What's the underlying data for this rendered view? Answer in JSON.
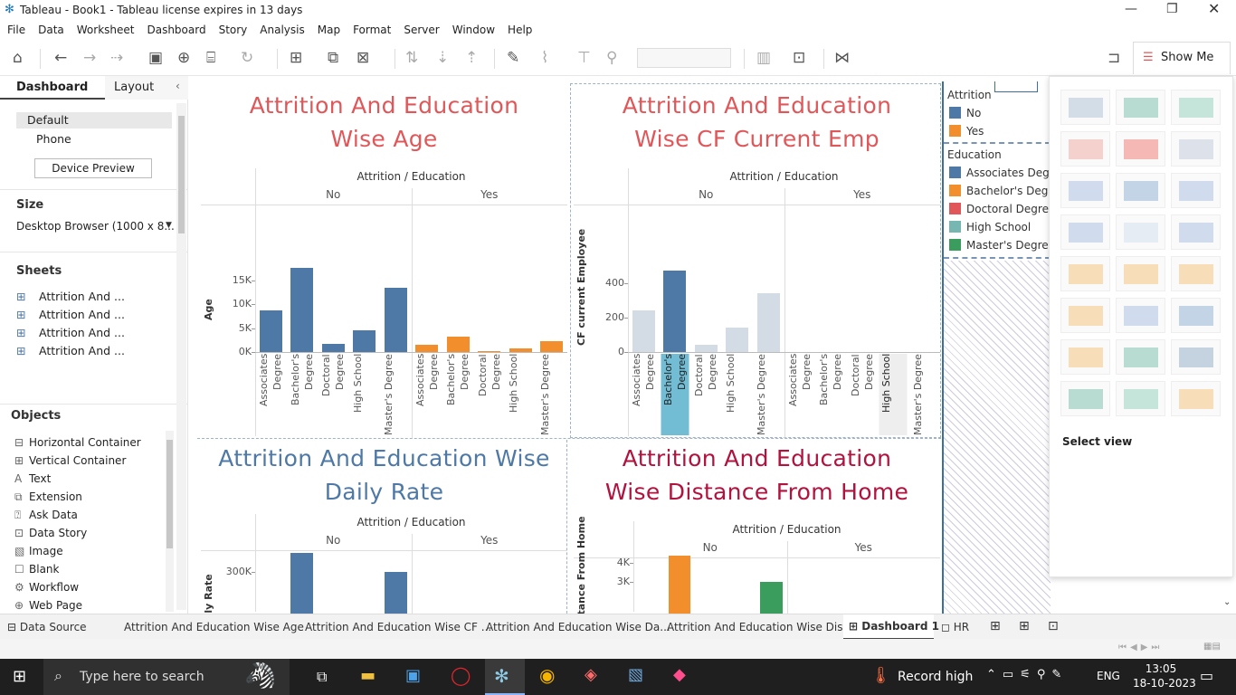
{
  "window": {
    "title": "Tableau - Book1 - Tableau license expires in 13 days"
  },
  "menu": [
    "File",
    "Data",
    "Worksheet",
    "Dashboard",
    "Story",
    "Analysis",
    "Map",
    "Format",
    "Server",
    "Window",
    "Help"
  ],
  "toolbar": {
    "show_me": "Show Me"
  },
  "left_pane": {
    "tabs": [
      "Dashboard",
      "Layout"
    ],
    "devices": [
      "Default",
      "Phone"
    ],
    "device_preview": "Device Preview",
    "size_label": "Size",
    "size_value": "Desktop Browser (1000 x 8...",
    "sheets_label": "Sheets",
    "sheets": [
      "Attrition And ...",
      "Attrition And ...",
      "Attrition And ...",
      "Attrition And ..."
    ],
    "objects_label": "Objects",
    "objects": [
      "Horizontal Container",
      "Vertical Container",
      "Text",
      "Extension",
      "Ask Data",
      "Data Story",
      "Image",
      "Blank",
      "Workflow",
      "Web Page"
    ]
  },
  "dashboard": {
    "col_header": "Attrition / Education",
    "groups": [
      "No",
      "Yes"
    ],
    "education": [
      "Associates Degree",
      "Bachelor's Degree",
      "Doctoral Degree",
      "High School",
      "Master's Degree"
    ]
  },
  "chart_data": [
    {
      "type": "bar",
      "title": "Attrition And Education Wise Age",
      "ylabel": "Age",
      "yticks": [
        "0K",
        "5K",
        "10K",
        "15K"
      ],
      "ylim": [
        0,
        18000
      ],
      "categories": [
        "Associates Degree",
        "Bachelor's Degree",
        "Doctoral Degree",
        "High School",
        "Master's Degree"
      ],
      "series": [
        {
          "name": "No",
          "values": [
            8800,
            17600,
            1700,
            4600,
            13400
          ],
          "color": "#4e79a7"
        },
        {
          "name": "Yes",
          "values": [
            1500,
            3300,
            200,
            800,
            2200
          ],
          "color": "#f28e2b"
        }
      ],
      "title_color": "#e15759"
    },
    {
      "type": "bar",
      "title": "Attrition And Education Wise CF Current Emp",
      "ylabel": "CF current Employee",
      "yticks": [
        "0",
        "200",
        "400"
      ],
      "ylim": [
        0,
        500
      ],
      "categories": [
        "Associates Degree",
        "Bachelor's Degree",
        "Doctoral Degree",
        "High School",
        "Master's Degree"
      ],
      "series": [
        {
          "name": "No",
          "values": [
            240,
            475,
            40,
            140,
            340
          ],
          "color": "#d3dbe4"
        },
        {
          "name": "Yes",
          "values": [
            0,
            0,
            0,
            0,
            0
          ],
          "color": "#d3dbe4"
        }
      ],
      "highlight": "Bachelor's Degree",
      "title_color": "#e15759"
    },
    {
      "type": "bar",
      "title": "Attrition And Education Wise Daily Rate",
      "ylabel": "Daily Rate",
      "yticks": [
        "300K"
      ],
      "ylim": [
        0,
        380000
      ],
      "categories": [
        "Associates Degree",
        "Bachelor's Degree",
        "Doctoral Degree",
        "High School",
        "Master's Degree"
      ],
      "series": [
        {
          "name": "No",
          "values": [
            0,
            370000,
            0,
            0,
            300000
          ],
          "color": "#4e79a7"
        }
      ],
      "title_color": "#4e79a7"
    },
    {
      "type": "bar",
      "title": "Attrition And Education Wise Distance From Home",
      "ylabel": "Distance From Home",
      "yticks": [
        "3K",
        "4K"
      ],
      "ylim": [
        0,
        4500
      ],
      "categories": [
        "Associates Degree",
        "Bachelor's Degree",
        "Doctoral Degree",
        "High School",
        "Master's Degree"
      ],
      "series": [
        {
          "name": "No",
          "values": [
            0,
            4400,
            0,
            0,
            3000
          ],
          "colors": [
            "#f28e2b",
            "#f28e2b",
            "#e15759",
            "#76b7b2",
            "#3a9d5d"
          ]
        }
      ],
      "title_color": "#b2123e"
    }
  ],
  "legend": {
    "attrition_title": "Attrition",
    "attrition": [
      {
        "label": "No",
        "color": "#4e79a7"
      },
      {
        "label": "Yes",
        "color": "#f28e2b"
      }
    ],
    "education_title": "Education",
    "education": [
      {
        "label": "Associates Degree",
        "color": "#4e79a7"
      },
      {
        "label": "Bachelor's Degree",
        "color": "#f28e2b"
      },
      {
        "label": "Doctoral Degree",
        "color": "#e15759"
      },
      {
        "label": "High School",
        "color": "#76b7b2"
      },
      {
        "label": "Master's Degree",
        "color": "#3a9d5d"
      }
    ]
  },
  "show_me": {
    "select_view": "Select view"
  },
  "bottom_tabs": {
    "data_source": "Data Source",
    "tabs": [
      "Attrition And Education Wise Age",
      "Attrition And Education Wise CF ...",
      "Attrition And Education Wise Da...",
      "Attrition And Education Wise Dis..."
    ],
    "active": "Dashboard 1",
    "hr": "HR"
  },
  "taskbar": {
    "search_placeholder": "Type here to search",
    "weather": "Record high",
    "lang": "ENG",
    "time": "13:05",
    "date": "18-10-2023"
  }
}
